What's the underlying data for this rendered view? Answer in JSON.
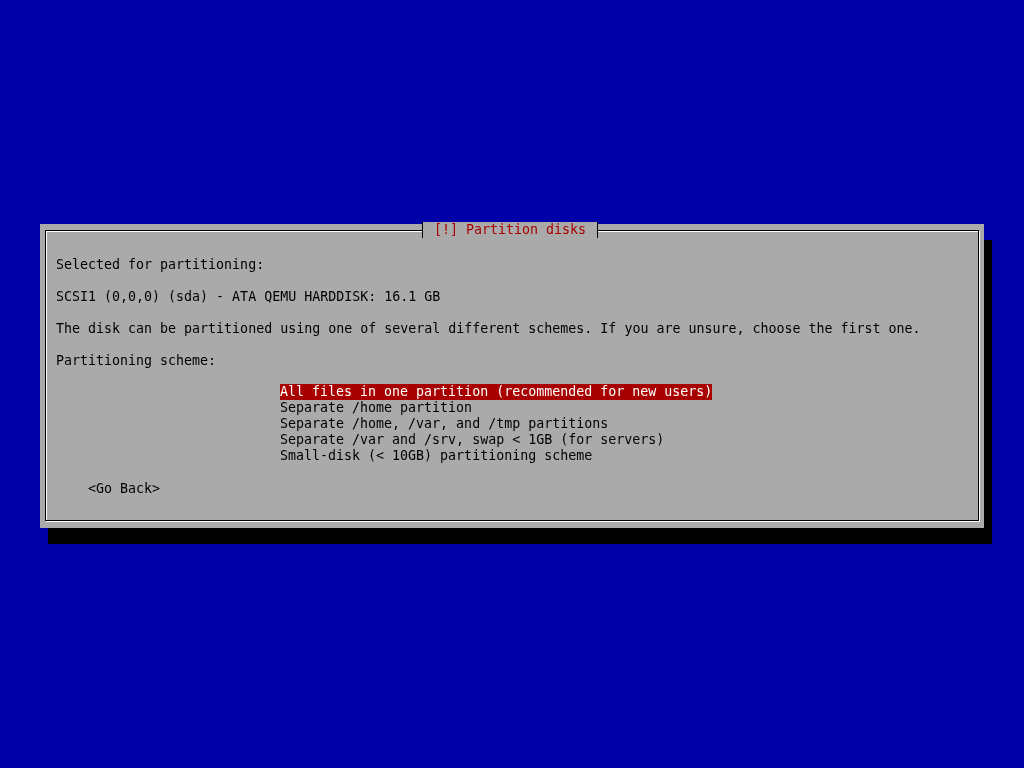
{
  "dialog": {
    "title": "[!] Partition disks",
    "paragraphs": [
      "Selected for partitioning:",
      "SCSI1 (0,0,0) (sda) - ATA QEMU HARDDISK: 16.1 GB",
      "The disk can be partitioned using one of several different schemes. If you are unsure, choose the first one.",
      "Partitioning scheme:"
    ],
    "options": [
      {
        "label": "All files in one partition (recommended for new users)",
        "selected": true
      },
      {
        "label": "Separate /home partition",
        "selected": false
      },
      {
        "label": "Separate /home, /var, and /tmp partitions",
        "selected": false
      },
      {
        "label": "Separate /var and /srv, swap < 1GB (for servers)",
        "selected": false
      },
      {
        "label": "Small-disk (< 10GB) partitioning scheme",
        "selected": false
      }
    ],
    "buttons": [
      "<Go Back>"
    ]
  }
}
